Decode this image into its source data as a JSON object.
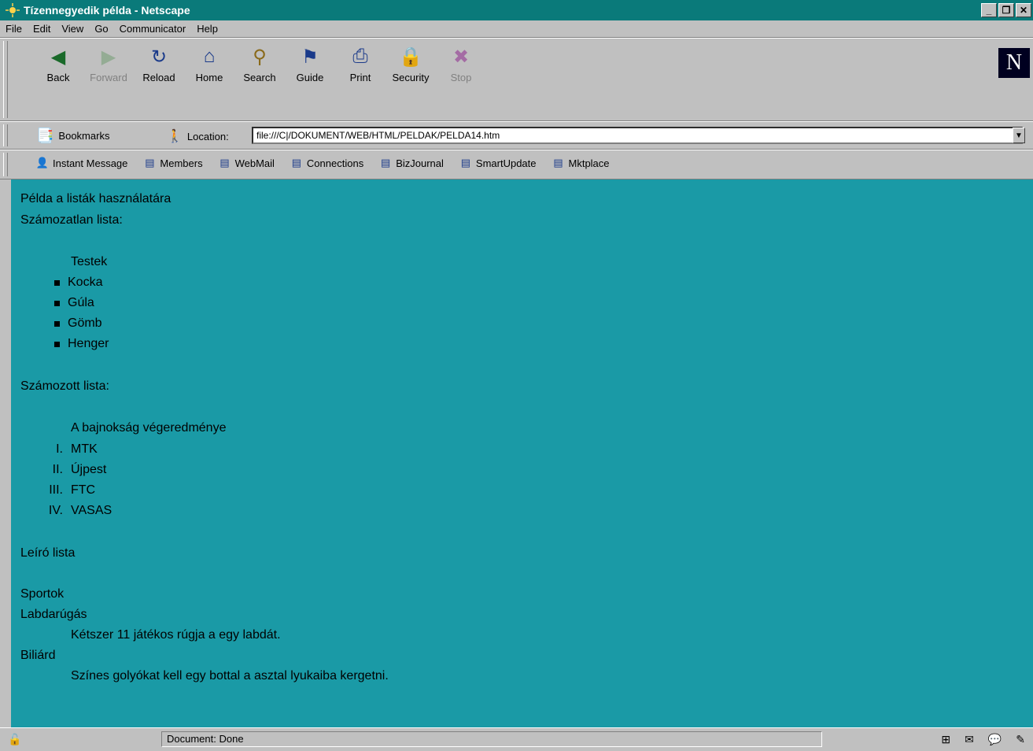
{
  "window": {
    "title": "Tízennegyedik példa - Netscape",
    "controls": [
      "_",
      "❐",
      "✕"
    ]
  },
  "menu": [
    "File",
    "Edit",
    "View",
    "Go",
    "Communicator",
    "Help"
  ],
  "nav_buttons": [
    {
      "label": "Back",
      "icon": "back-arrow-icon",
      "glyph": "◀",
      "color": "#1a6a2a",
      "disabled": false
    },
    {
      "label": "Forward",
      "icon": "forward-arrow-icon",
      "glyph": "▶",
      "color": "#6a9a6a",
      "disabled": true
    },
    {
      "label": "Reload",
      "icon": "reload-icon",
      "glyph": "↻",
      "color": "#1a3a8a",
      "disabled": false
    },
    {
      "label": "Home",
      "icon": "home-icon",
      "glyph": "⌂",
      "color": "#1a3a8a",
      "disabled": false
    },
    {
      "label": "Search",
      "icon": "search-icon",
      "glyph": "⚲",
      "color": "#8a6a1a",
      "disabled": false
    },
    {
      "label": "Guide",
      "icon": "guide-icon",
      "glyph": "⚑",
      "color": "#1a3a8a",
      "disabled": false
    },
    {
      "label": "Print",
      "icon": "print-icon",
      "glyph": "⎙",
      "color": "#1a3a8a",
      "disabled": false
    },
    {
      "label": "Security",
      "icon": "security-lock-icon",
      "glyph": "🔒",
      "color": "#8a1a1a",
      "disabled": false
    },
    {
      "label": "Stop",
      "icon": "stop-icon",
      "glyph": "✖",
      "color": "#8a1a8a",
      "disabled": true
    }
  ],
  "location": {
    "bookmarks_label": "Bookmarks",
    "location_label": "Location:",
    "url": "file:///C|/DOKUMENT/WEB/HTML/PELDAK/PELDA14.htm"
  },
  "personal_bar": [
    {
      "label": "Instant Message",
      "icon": "instant-message-icon",
      "glyph": "👤"
    },
    {
      "label": "Members",
      "icon": "bookmark-folder-icon",
      "glyph": "▤"
    },
    {
      "label": "WebMail",
      "icon": "bookmark-folder-icon",
      "glyph": "▤"
    },
    {
      "label": "Connections",
      "icon": "bookmark-folder-icon",
      "glyph": "▤"
    },
    {
      "label": "BizJournal",
      "icon": "bookmark-folder-icon",
      "glyph": "▤"
    },
    {
      "label": "SmartUpdate",
      "icon": "bookmark-folder-icon",
      "glyph": "▤"
    },
    {
      "label": "Mktplace",
      "icon": "bookmark-folder-icon",
      "glyph": "▤"
    }
  ],
  "content": {
    "heading": "Példa a listák használatára",
    "unordered_title": "Számozatlan lista:",
    "unordered_caption": "Testek",
    "unordered_items": [
      "Kocka",
      "Gúla",
      "Gömb",
      "Henger"
    ],
    "ordered_title": "Számozott lista:",
    "ordered_caption": "A bajnokság végeredménye",
    "ordered_items": [
      {
        "num": "I.",
        "text": "MTK"
      },
      {
        "num": "II.",
        "text": "Újpest"
      },
      {
        "num": "III.",
        "text": "FTC"
      },
      {
        "num": "IV.",
        "text": "VASAS"
      }
    ],
    "def_title": "Leíró lista",
    "def_list": [
      {
        "term": "Sportok",
        "desc": ""
      },
      {
        "term": "Labdarúgás",
        "desc": "Kétszer 11 játékos rúgja a egy labdát."
      },
      {
        "term": "Biliárd",
        "desc": "Színes golyókat kell egy bottal a asztal lyukaiba kergetni."
      }
    ]
  },
  "status": {
    "text": "Document: Done",
    "component_icons": [
      "navigator-icon",
      "mail-icon",
      "discussion-icon",
      "composer-icon"
    ]
  },
  "colors": {
    "title_bar": "#0a7a7a",
    "page_background": "#1a9aa6",
    "chrome": "#c0c0c0"
  }
}
